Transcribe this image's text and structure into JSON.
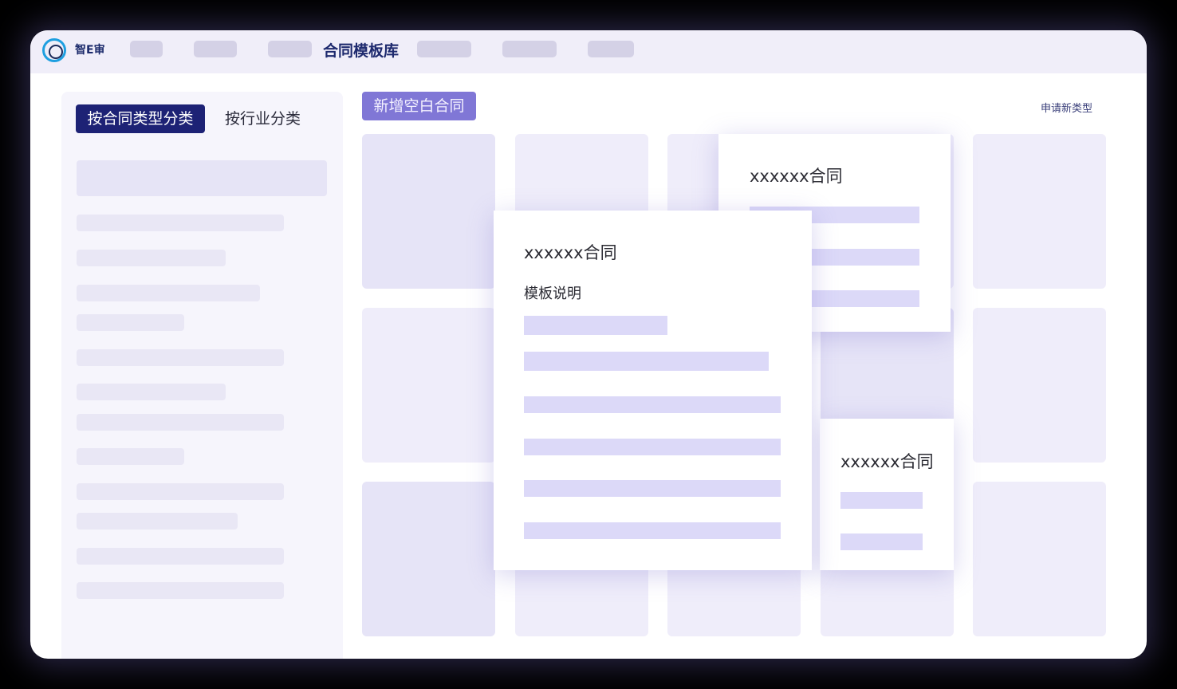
{
  "app": {
    "brand": "智E审",
    "active_nav": "合同模板库"
  },
  "sidebar": {
    "tabs": [
      {
        "label": "按合同类型分类",
        "active": true
      },
      {
        "label": "按行业分类",
        "active": false
      }
    ]
  },
  "main": {
    "add_button": "新增空白合同",
    "apply_link": "申请新类型"
  },
  "popups": {
    "back": {
      "title": "xxxxxx合同"
    },
    "front": {
      "title": "xxxxxx合同",
      "subtitle": "模板说明"
    },
    "small": {
      "title": "xxxxxx合同"
    }
  },
  "colors": {
    "accent": "#1d2275",
    "button": "#8077d6",
    "placeholder": "#dcd9f8",
    "topbar": "#f0eef9"
  }
}
